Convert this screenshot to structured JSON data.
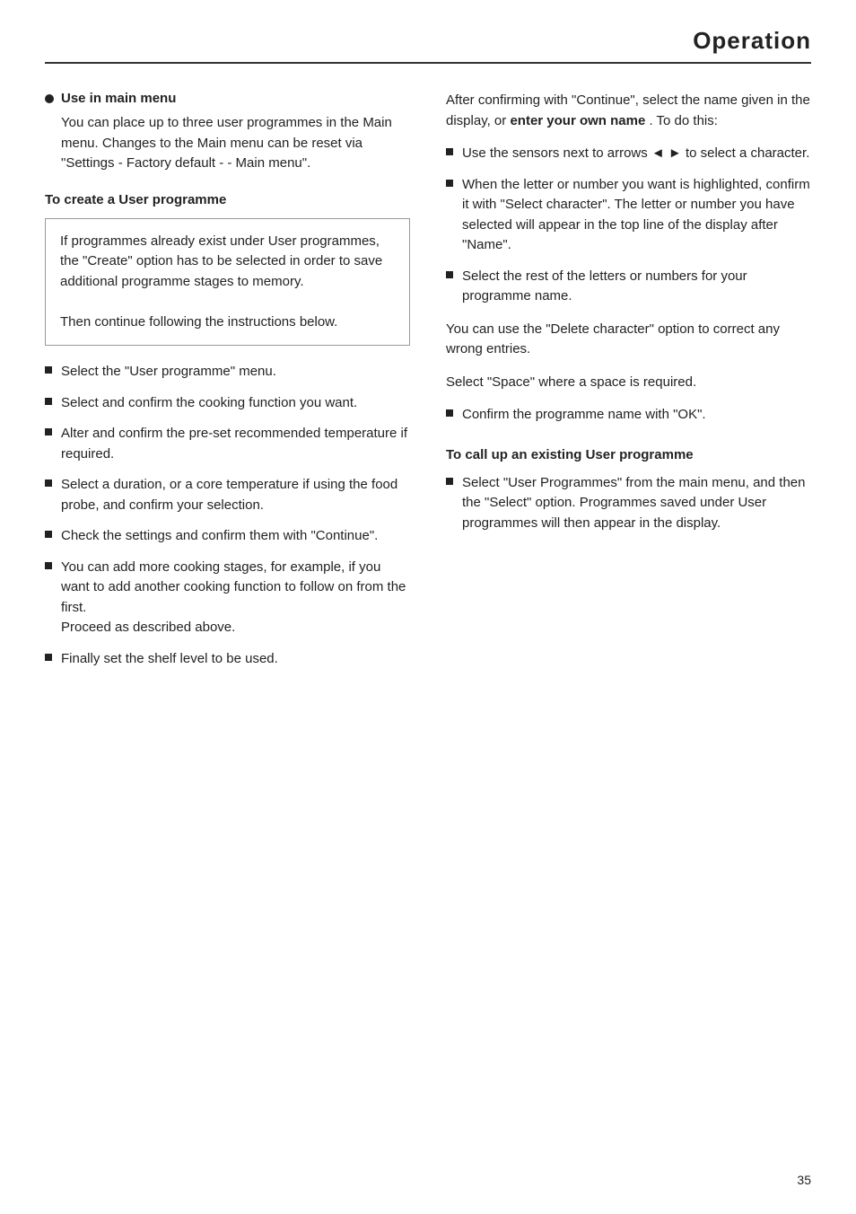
{
  "header": {
    "title": "Operation"
  },
  "left_column": {
    "use_in_main_menu": {
      "heading": "Use in main menu",
      "body": "You can place up to three user programmes in the Main menu. Changes to the Main menu can be reset via \"Settings - Factory default - - Main menu\"."
    },
    "to_create_heading": "To create a User programme",
    "info_box": {
      "line1": "If programmes already exist under User programmes, the \"Create\" option has to be selected in order to save additional programme stages to memory.",
      "line2": "Then continue following the instructions below."
    },
    "list_items": [
      "Select the \"User programme\" menu.",
      "Select and confirm the cooking function you want.",
      "Alter and confirm the pre-set recommended temperature if required.",
      "Select a duration, or a core temperature if using the food probe, and confirm your selection.",
      "Check the settings and confirm them with \"Continue\".",
      "You can add more cooking stages, for example, if you want to add another cooking function to follow on from the first.\nProceed as described above.",
      "Finally set the shelf level to be used."
    ]
  },
  "right_column": {
    "intro_text": "After confirming with \"Continue\", select the name given in the display, or",
    "intro_bold": "enter your own name",
    "intro_end": ". To do this:",
    "list_items": [
      {
        "text": "Use the sensors next to arrows ◄ ► to select a character."
      },
      {
        "text": "When the letter or number you want is highlighted, confirm it with \"Select character\".  The letter or number you have selected will appear in the top line of the display after \"Name\"."
      },
      {
        "text": "Select the rest of the letters or numbers for your programme name."
      }
    ],
    "para1": "You can use the \"Delete character\" option to correct any wrong entries.",
    "para2": "Select \"Space\" where a space is required.",
    "list_items2": [
      {
        "text": "Confirm the programme name with \"OK\"."
      }
    ],
    "to_call_heading": "To call up an existing User programme",
    "to_call_list": [
      {
        "text": "Select \"User Programmes\" from the main menu, and then the \"Select\" option. Programmes saved under User programmes will then appear in the display."
      }
    ]
  },
  "page_number": "35"
}
